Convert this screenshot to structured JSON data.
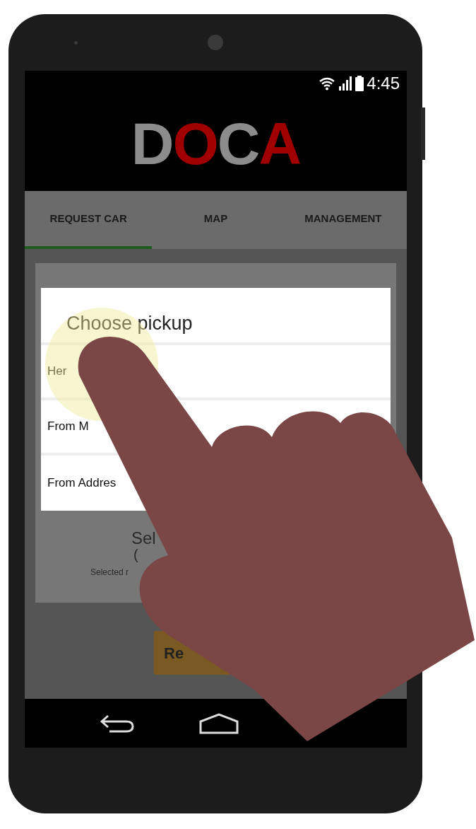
{
  "status_bar": {
    "time": "4:45"
  },
  "logo": {
    "letters": [
      {
        "text": "D",
        "color": "#8c8c8c"
      },
      {
        "text": "O",
        "color": "#a00000"
      },
      {
        "text": "C",
        "color": "#8c8c8c"
      },
      {
        "text": "A",
        "color": "#a00000"
      }
    ]
  },
  "tabs": [
    {
      "label": "REQUEST CAR",
      "selected": true
    },
    {
      "label": "MAP",
      "selected": false
    },
    {
      "label": "MANAGEMENT",
      "selected": false
    }
  ],
  "dialog": {
    "title": "Choose pickup",
    "options": [
      {
        "label": "Her"
      },
      {
        "label": "From M"
      },
      {
        "label": "From Addres"
      }
    ]
  },
  "background_card": {
    "heading": "Sel",
    "subheading": "(",
    "note": "Selected r"
  },
  "request_button": {
    "label": "Re"
  }
}
